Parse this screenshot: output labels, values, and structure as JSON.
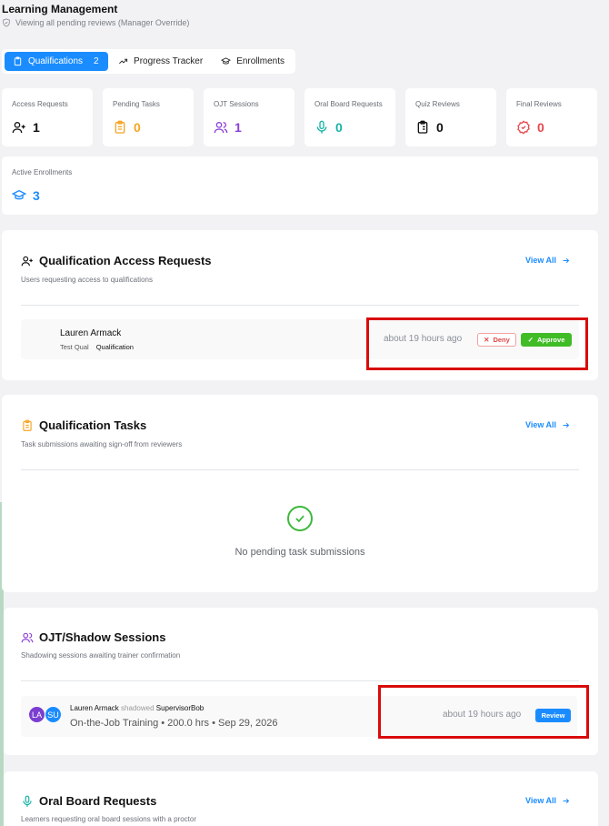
{
  "header": {
    "title": "Learning Management",
    "subtitle": "Viewing all pending reviews (Manager Override)"
  },
  "tabs": [
    {
      "label": "Qualifications",
      "count": "2"
    },
    {
      "label": "Progress Tracker"
    },
    {
      "label": "Enrollments"
    }
  ],
  "stats": [
    {
      "label": "Access Requests",
      "value": "1",
      "color": "#111111",
      "icon": "user-plus-icon"
    },
    {
      "label": "Pending Tasks",
      "value": "0",
      "color": "#f5a524",
      "icon": "clipboard-icon"
    },
    {
      "label": "OJT Sessions",
      "value": "1",
      "color": "#8b3fd6",
      "icon": "users-icon"
    },
    {
      "label": "Oral Board Requests",
      "value": "0",
      "color": "#17b2a8",
      "icon": "microphone-icon"
    },
    {
      "label": "Quiz Reviews",
      "value": "0",
      "color": "#111111",
      "icon": "clipboard-list-icon"
    },
    {
      "label": "Final Reviews",
      "value": "0",
      "color": "#e5484d",
      "icon": "badge-check-icon"
    },
    {
      "label": "Active Enrollments",
      "value": "3",
      "color": "#1b8cff",
      "icon": "graduation-cap-icon"
    }
  ],
  "access": {
    "title": "Qualification Access Requests",
    "subtitle": "Users requesting access to qualifications",
    "view_all": "View All",
    "request": {
      "name": "Lauren Armack",
      "qual": "Test Qual",
      "type": "Qualification",
      "time": "about 19 hours ago",
      "deny": "Deny",
      "approve": "Approve"
    }
  },
  "tasks": {
    "title": "Qualification Tasks",
    "subtitle": "Task submissions awaiting sign-off from reviewers",
    "view_all": "View All",
    "empty": "No pending task submissions"
  },
  "ojt": {
    "title": "OJT/Shadow Sessions",
    "subtitle": "Shadowing sessions awaiting trainer confirmation",
    "session": {
      "avatar1": "LA",
      "avatar2": "SU",
      "trainee": "Lauren Armack",
      "verb": "shadowed",
      "trainer": "SupervisorBob",
      "details": "On-the-Job Training • 200.0 hrs • Sep 29, 2026",
      "time": "about 19 hours ago",
      "review": "Review"
    }
  },
  "oral": {
    "title": "Oral Board Requests",
    "subtitle": "Learners requesting oral board sessions with a proctor",
    "view_all": "View All"
  }
}
